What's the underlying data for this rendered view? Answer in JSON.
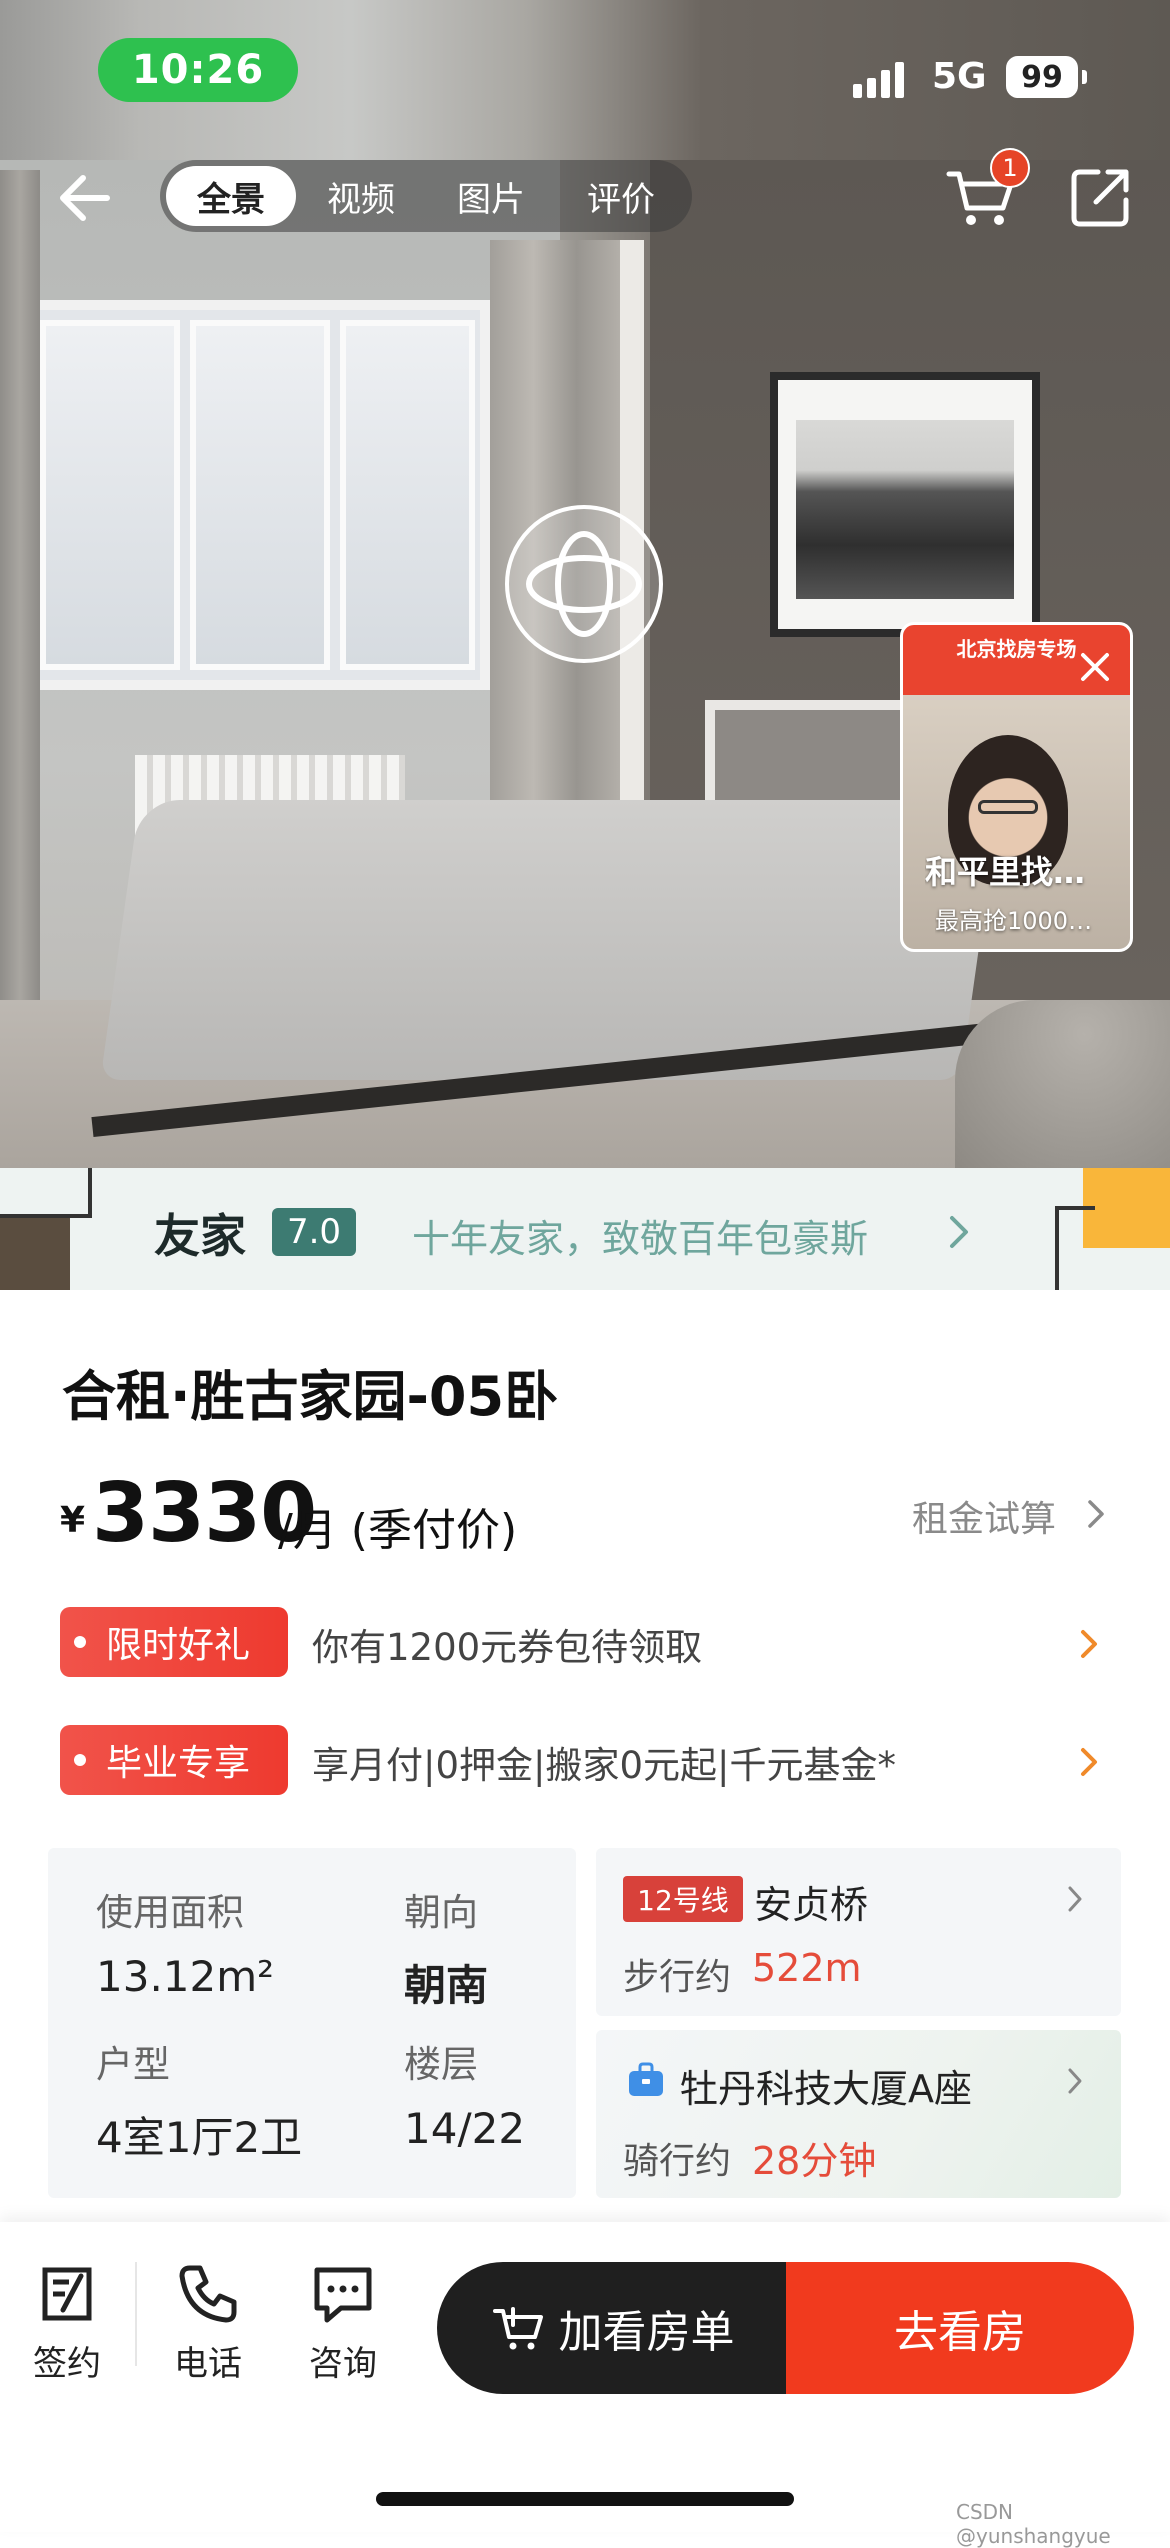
{
  "status_bar": {
    "time": "10:26",
    "network": "5G",
    "battery": "99"
  },
  "nav": {
    "tabs": [
      "全景",
      "视频",
      "图片",
      "评价"
    ],
    "active_tab": "全景",
    "cart_count": "1"
  },
  "live_card": {
    "header": "北京找房专场",
    "title": "和平里找…",
    "subtitle": "最高抢1000…"
  },
  "banner": {
    "brand": "友家",
    "score": "7.0",
    "slogan": "十年友家，致敬百年包豪斯"
  },
  "listing": {
    "title": "合租·胜古家园-05卧",
    "currency": "¥",
    "price": "3330",
    "price_unit": "/月 (季付价)",
    "rent_calc_label": "租金试算"
  },
  "promos": [
    {
      "tag": "限时好礼",
      "text": "你有1200元券包待领取"
    },
    {
      "tag": "毕业专享",
      "text": "享月付|0押金|搬家0元起|千元基金*"
    }
  ],
  "details": {
    "area_label": "使用面积",
    "area_value": "13.12m²",
    "orientation_label": "朝向",
    "orientation_value": "朝南",
    "layout_label": "户型",
    "layout_value": "4室1厅2卫",
    "floor_label": "楼层",
    "floor_value": "14/22"
  },
  "metro": {
    "line": "12号线",
    "station": "安贞桥",
    "walk_label": "步行约",
    "walk_value": "522m"
  },
  "work": {
    "place": "牡丹科技大厦A座",
    "ride_label": "骑行约",
    "ride_value": "28分钟"
  },
  "bottom_bar": {
    "sign_label": "签约",
    "phone_label": "电话",
    "consult_label": "咨询",
    "add_button": "加看房单",
    "go_button": "去看房"
  },
  "watermark": "CSDN @yunshangyue",
  "colors": {
    "accent": "#f13a1e",
    "price_red": "#e54c3a",
    "brand_green": "#3d7b72",
    "status_green": "#2ec14f",
    "dark_button": "#1f1f1f"
  }
}
